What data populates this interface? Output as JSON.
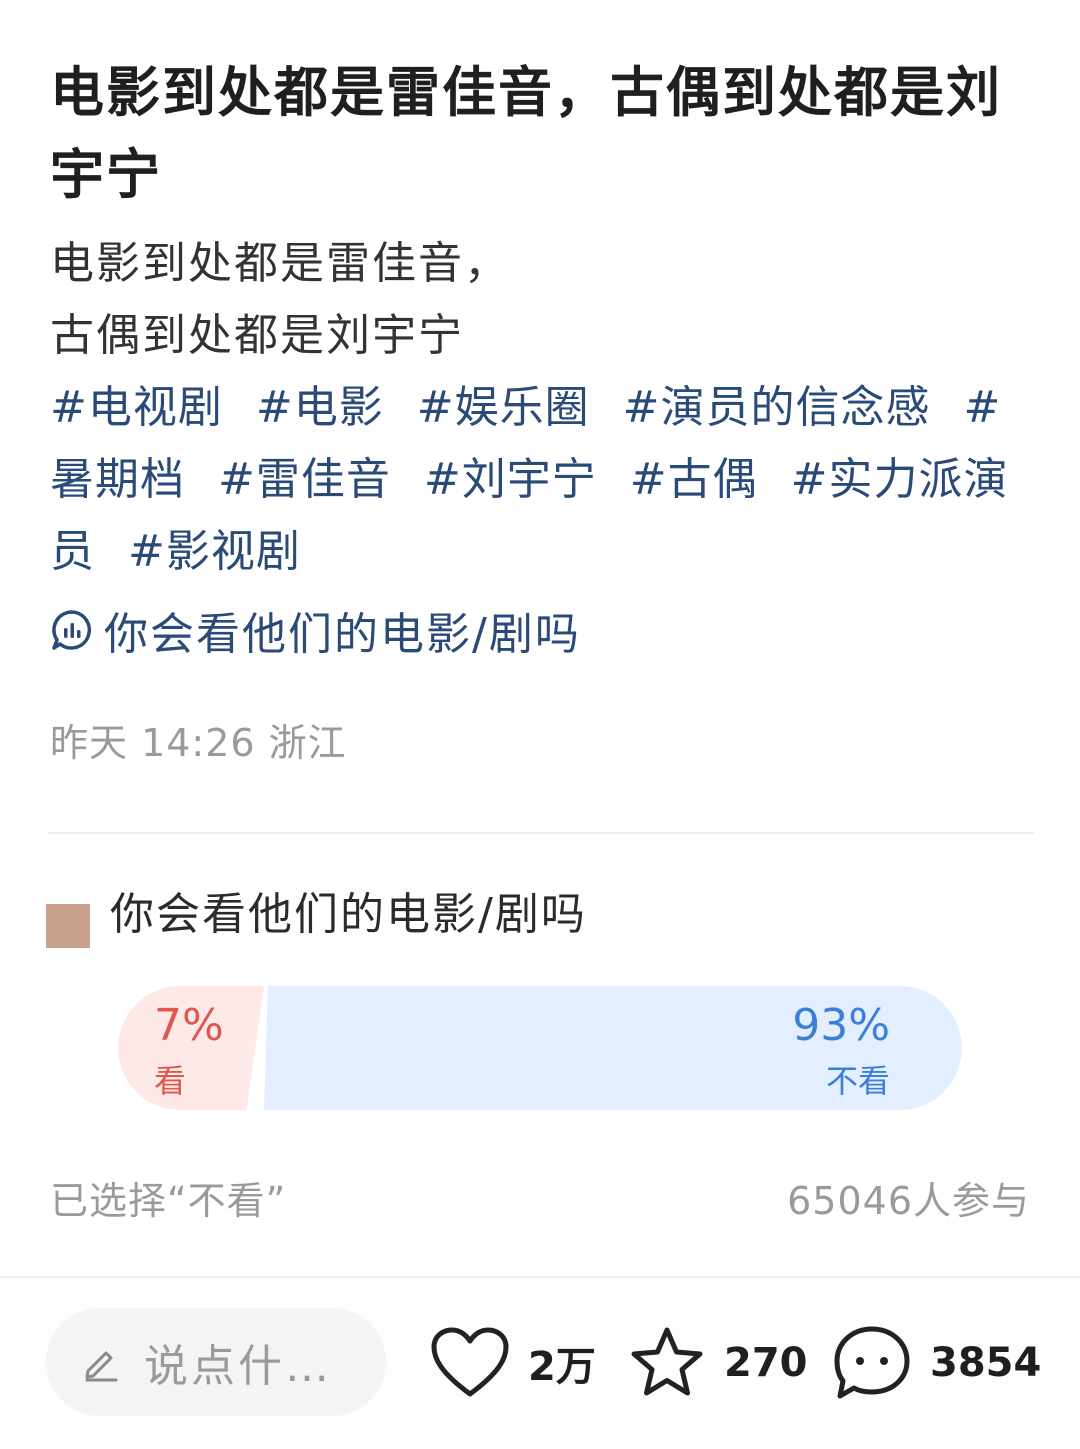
{
  "post": {
    "title": "电影到处都是雷佳音，古偶到处都是刘宇宁",
    "body_line1": "电影到处都是雷佳音，",
    "body_line2": "古偶到处都是刘宇宁",
    "tags": [
      "#电视剧",
      "#电影",
      "#娱乐圈",
      "#演员的信念感",
      "#暑期档",
      "#雷佳音",
      "#刘宇宁",
      "#古偶",
      "#实力派演员",
      "#影视剧"
    ],
    "poll_link_text": "你会看他们的电影/剧吗",
    "meta": "昨天 14:26 浙江"
  },
  "poll": {
    "title": "你会看他们的电影/剧吗",
    "square_color": "#c9a28e",
    "options": [
      {
        "percent": "7%",
        "label": "看",
        "value": 7,
        "color": "#e0574f"
      },
      {
        "percent": "93%",
        "label": "不看",
        "value": 93,
        "color": "#3b7fd9"
      }
    ],
    "selected_text": "已选择“不看”",
    "participants": "65046人参与"
  },
  "bottom_bar": {
    "comment_placeholder": "说点什…",
    "likes": "2万",
    "favorites": "270",
    "comments": "3854"
  },
  "icons": {
    "poll": "poll-chat-icon",
    "pencil": "pencil-icon",
    "like": "heart-icon",
    "favorite": "star-icon",
    "comment": "comment-bubble-icon"
  }
}
